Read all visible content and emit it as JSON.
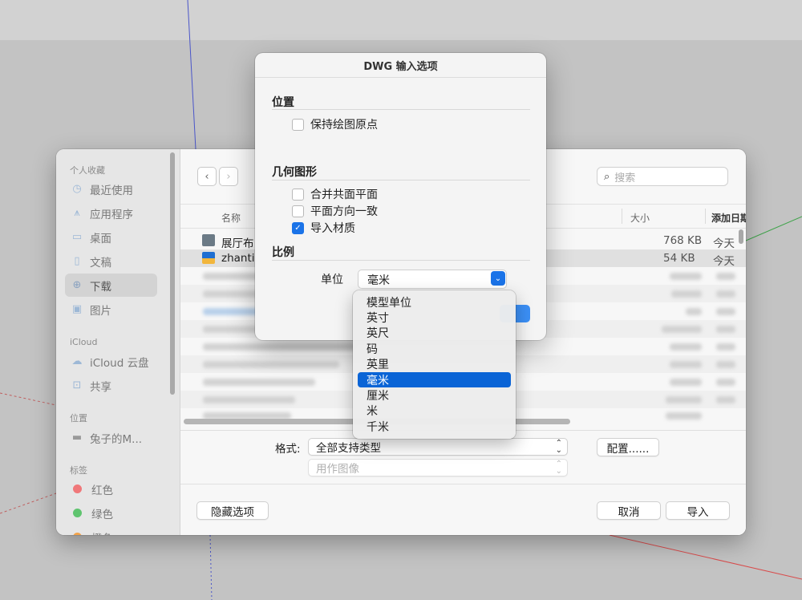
{
  "dwg_dialog": {
    "title": "DWG 输入选项",
    "position_group": {
      "title": "位置",
      "keep_origin": {
        "label": "保持绘图原点",
        "checked": false
      }
    },
    "geometry_group": {
      "title": "几何图形",
      "merge_coplanar": {
        "label": "合并共面平面",
        "checked": false
      },
      "orient_faces": {
        "label": "平面方向一致",
        "checked": false
      },
      "import_materials": {
        "label": "导入材质",
        "checked": true
      }
    },
    "scale_group": {
      "title": "比例",
      "unit_label": "单位",
      "unit_value": "毫米"
    },
    "unit_menu": {
      "items": [
        "模型单位",
        "英寸",
        "英尺",
        "码",
        "英里",
        "毫米",
        "厘米",
        "米",
        "千米"
      ],
      "selected": "毫米"
    }
  },
  "file_dialog": {
    "sidebar": {
      "favorites_title": "个人收藏",
      "favorites": [
        {
          "label": "最近使用",
          "icon": "clock-icon"
        },
        {
          "label": "应用程序",
          "icon": "apps-icon"
        },
        {
          "label": "桌面",
          "icon": "desktop-icon"
        },
        {
          "label": "文稿",
          "icon": "document-icon"
        },
        {
          "label": "下载",
          "icon": "download-icon",
          "active": true
        },
        {
          "label": "图片",
          "icon": "photo-icon"
        }
      ],
      "icloud_title": "iCloud",
      "icloud": [
        {
          "label": "iCloud 云盘",
          "icon": "cloud-icon"
        },
        {
          "label": "共享",
          "icon": "shared-folder-icon"
        }
      ],
      "locations_title": "位置",
      "locations": [
        {
          "label": "兔子的M...",
          "icon": "laptop-icon"
        }
      ],
      "tags_title": "标签",
      "tags": [
        {
          "label": "红色",
          "color": "#f0787a"
        },
        {
          "label": "绿色",
          "color": "#5fc46f"
        },
        {
          "label": "橙色",
          "color": "#f2a34a"
        }
      ]
    },
    "toolbar": {
      "back": "‹",
      "forward": "›",
      "search_placeholder": "搜索"
    },
    "columns": {
      "name": "名称",
      "size": "大小",
      "date_added": "添加日期"
    },
    "files": [
      {
        "name": "展厅布",
        "size": "768 KB",
        "date": "今天"
      },
      {
        "name": "zhanti",
        "size": "54 KB",
        "date": "今天"
      }
    ],
    "format_label": "格式:",
    "format_value": "全部支持类型",
    "configure_label": "配置......",
    "use_as_image": "用作图像",
    "hide_options": "隐藏选项",
    "cancel": "取消",
    "import": "导入"
  },
  "colors": {
    "accent": "#1a73e8",
    "menu_highlight": "#0a64d6"
  }
}
